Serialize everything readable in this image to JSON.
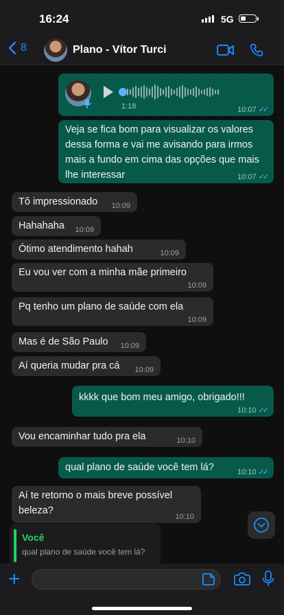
{
  "status": {
    "time": "16:24",
    "network": "5G"
  },
  "header": {
    "back_count": "8",
    "contact_name": "Plano - Vítor Turci"
  },
  "voice_message": {
    "duration": "1:18",
    "time": "10:07"
  },
  "messages": [
    {
      "dir": "out",
      "text": "Veja se fica bom para visualizar os valores dessa forma e vai me avisando para irmos mais a fundo em cima das opções que mais lhe interessar",
      "time": "10:07"
    },
    {
      "dir": "in",
      "text": "Tô impressionado",
      "time": "10:09"
    },
    {
      "dir": "in",
      "text": "Hahahaha",
      "time": "10:09"
    },
    {
      "dir": "in",
      "text": "Ótimo atendimento hahah",
      "time": "10:09"
    },
    {
      "dir": "in",
      "text": "Eu vou ver com a minha mãe primeiro",
      "time": "10:09"
    },
    {
      "dir": "in",
      "text": "Pq tenho um plano de saúde com ela",
      "time": "10:09"
    },
    {
      "dir": "in",
      "text": "Mas é de São Paulo",
      "time": "10:09"
    },
    {
      "dir": "in",
      "text": "Aí queria mudar pra cá",
      "time": "10:09"
    },
    {
      "dir": "out",
      "text": "kkkk que bom meu amigo, obrigado!!!",
      "time": "10:10"
    },
    {
      "dir": "in",
      "text": "Vou encaminhar tudo pra ela",
      "time": "10:10"
    },
    {
      "dir": "out",
      "text": "qual plano de saúde você tem lá?",
      "time": "10:10"
    },
    {
      "dir": "in",
      "text": "Aí te retorno o mais breve possível beleza?",
      "time": "10:10"
    }
  ],
  "reply_preview": {
    "author": "Você",
    "text": "qual plano de saúde você tem lá?"
  },
  "icons": {
    "back": "chevron-left-icon",
    "video": "video-camera-icon",
    "call": "phone-icon",
    "play": "play-icon",
    "scroll": "chevron-down-icon",
    "attach": "plus-icon",
    "sticker": "sticker-icon",
    "camera": "camera-icon",
    "mic": "microphone-icon"
  },
  "colors": {
    "accent": "#1a8cff",
    "outgoing": "#075a4a",
    "incoming": "#2b2b2d",
    "read_tick": "#5ab2ff",
    "reply_bar": "#25d366"
  }
}
